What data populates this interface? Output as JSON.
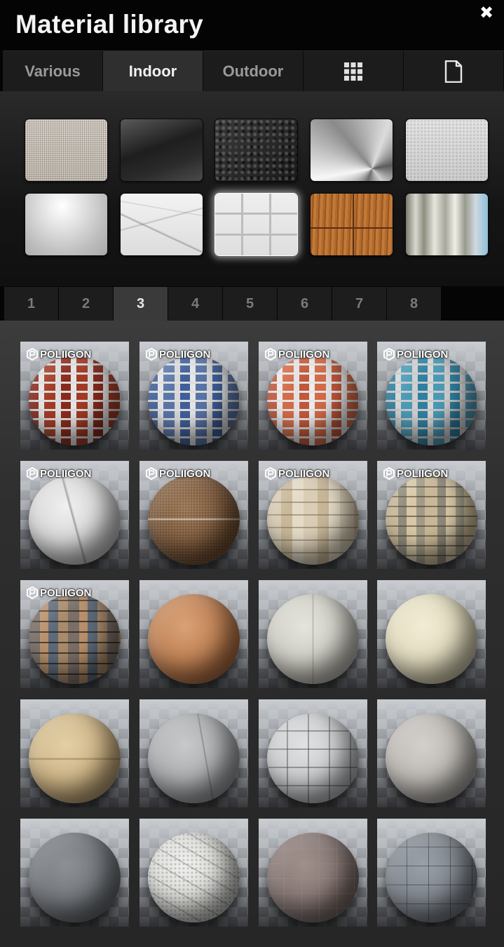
{
  "window": {
    "title": "Material library",
    "close_icon": "close-icon"
  },
  "tabs": [
    {
      "label": "Various",
      "active": false
    },
    {
      "label": "Indoor",
      "active": true
    },
    {
      "label": "Outdoor",
      "active": false
    },
    {
      "label": "",
      "icon": "grid-icon",
      "active": false
    },
    {
      "label": "",
      "icon": "document-icon",
      "active": false
    }
  ],
  "swatches": [
    {
      "name": "fabric",
      "selected": false
    },
    {
      "name": "glass",
      "selected": false
    },
    {
      "name": "leather",
      "selected": false
    },
    {
      "name": "brushed-metal",
      "selected": false
    },
    {
      "name": "plaster",
      "selected": false
    },
    {
      "name": "glossy-white",
      "selected": false
    },
    {
      "name": "marble",
      "selected": false
    },
    {
      "name": "tiles",
      "selected": true
    },
    {
      "name": "wood",
      "selected": false
    },
    {
      "name": "curtain",
      "selected": false
    }
  ],
  "pages": [
    "1",
    "2",
    "3",
    "4",
    "5",
    "6",
    "7",
    "8"
  ],
  "active_page": "3",
  "badge_text": "POLIIGON",
  "materials": [
    {
      "material": "brick-red",
      "badge": true
    },
    {
      "material": "brick-blue",
      "badge": true
    },
    {
      "material": "brick-orange",
      "badge": true
    },
    {
      "material": "brick-teal",
      "badge": true
    },
    {
      "material": "marble-white",
      "badge": true
    },
    {
      "material": "earth",
      "badge": true
    },
    {
      "material": "stone-tan",
      "badge": true
    },
    {
      "material": "stone-mixed",
      "badge": true
    },
    {
      "material": "slate",
      "badge": true
    },
    {
      "material": "terracotta",
      "badge": false
    },
    {
      "material": "concrete-light",
      "badge": false
    },
    {
      "material": "cream",
      "badge": false
    },
    {
      "material": "sandstone",
      "badge": false
    },
    {
      "material": "grey-smooth",
      "badge": false
    },
    {
      "material": "grey-tile",
      "badge": false
    },
    {
      "material": "grey-warm",
      "badge": false
    },
    {
      "material": "dark-grey",
      "badge": false
    },
    {
      "material": "white-stone",
      "badge": false
    },
    {
      "material": "mauve",
      "badge": false
    },
    {
      "material": "blue-grey",
      "badge": false
    }
  ]
}
